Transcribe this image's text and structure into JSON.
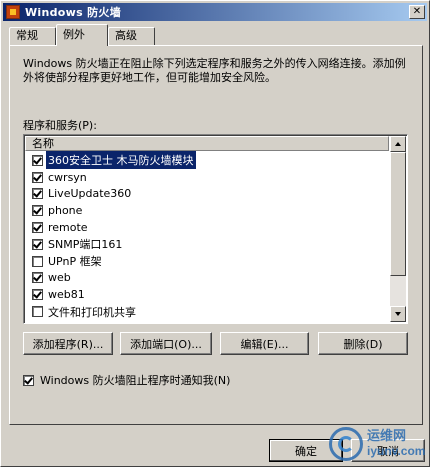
{
  "window": {
    "title": "Windows 防火墙"
  },
  "tabs": [
    {
      "label": "常规"
    },
    {
      "label": "例外"
    },
    {
      "label": "高级"
    }
  ],
  "description": "Windows 防火墙正在阻止除下列选定程序和服务之外的传入网络连接。添加例外将使部分程序更好地工作，但可能增加安全风险。",
  "list": {
    "label": "程序和服务(P):",
    "header": "名称",
    "items": [
      {
        "label": "360安全卫士 木马防火墙模块",
        "checked": true,
        "selected": true
      },
      {
        "label": "cwrsyn",
        "checked": true
      },
      {
        "label": "LiveUpdate360",
        "checked": true
      },
      {
        "label": "phone",
        "checked": true
      },
      {
        "label": "remote",
        "checked": true
      },
      {
        "label": "SNMP端口161",
        "checked": true
      },
      {
        "label": "UPnP 框架",
        "checked": false
      },
      {
        "label": "web",
        "checked": true
      },
      {
        "label": "web81",
        "checked": true
      },
      {
        "label": "文件和打印机共享",
        "checked": false
      }
    ]
  },
  "buttons": {
    "add_program": "添加程序(R)...",
    "add_port": "添加端口(O)...",
    "edit": "编辑(E)...",
    "delete": "删除(D)",
    "ok": "确定",
    "cancel": "取消"
  },
  "notify": {
    "label": "Windows 防火墙阻止程序时通知我(N)",
    "checked": true
  },
  "watermark": {
    "cn": "运维网",
    "en": "iyunv.com"
  }
}
